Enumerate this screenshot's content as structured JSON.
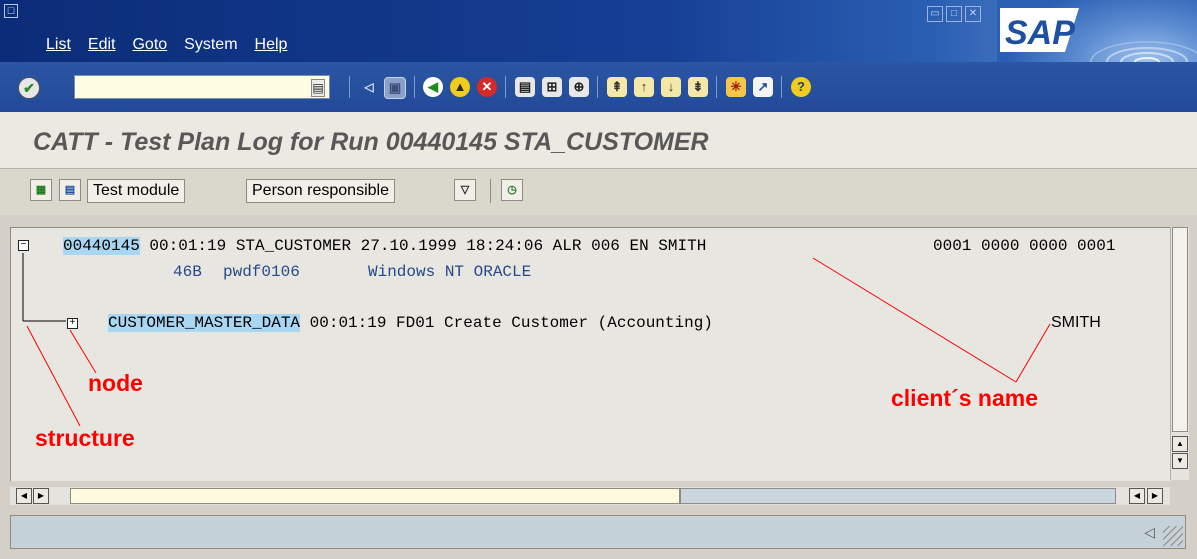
{
  "window": {
    "menu": [
      {
        "label": "List",
        "underline": "L"
      },
      {
        "label": "Edit",
        "underline": "E"
      },
      {
        "label": "Goto",
        "underline": "G"
      },
      {
        "label": "System",
        "underline": "y"
      },
      {
        "label": "Help",
        "underline": "H"
      }
    ],
    "logo": "SAP"
  },
  "command_field": {
    "value": "",
    "placeholder": ""
  },
  "screen": {
    "title": "CATT - Test Plan Log for Run 00440145 STA_CUSTOMER"
  },
  "app_toolbar": {
    "test_module_label": "Test module",
    "person_responsible_label": "Person responsible"
  },
  "log": {
    "row1": {
      "run_id": "00440145",
      "rest": " 00:01:19 STA_CUSTOMER 27.10.1999 18:24:06 ALR 006 EN SMITH",
      "counters": "0001 0000 0000 0001"
    },
    "row2": {
      "release": "46B",
      "host": "pwdf0106",
      "system": "Windows NT ORACLE"
    },
    "row3": {
      "module": "CUSTOMER_MASTER_DATA",
      "rest": " 00:01:19 FD01 Create Customer (Accounting)",
      "responsible": "SMITH"
    }
  },
  "annotations": {
    "node": "node",
    "structure": "structure",
    "client_name": "client´s name"
  },
  "colors": {
    "menubar": "#163f94",
    "highlight": "#a9d6f2",
    "annotation": "#ff0000",
    "content_bg": "#e8e6e0"
  }
}
